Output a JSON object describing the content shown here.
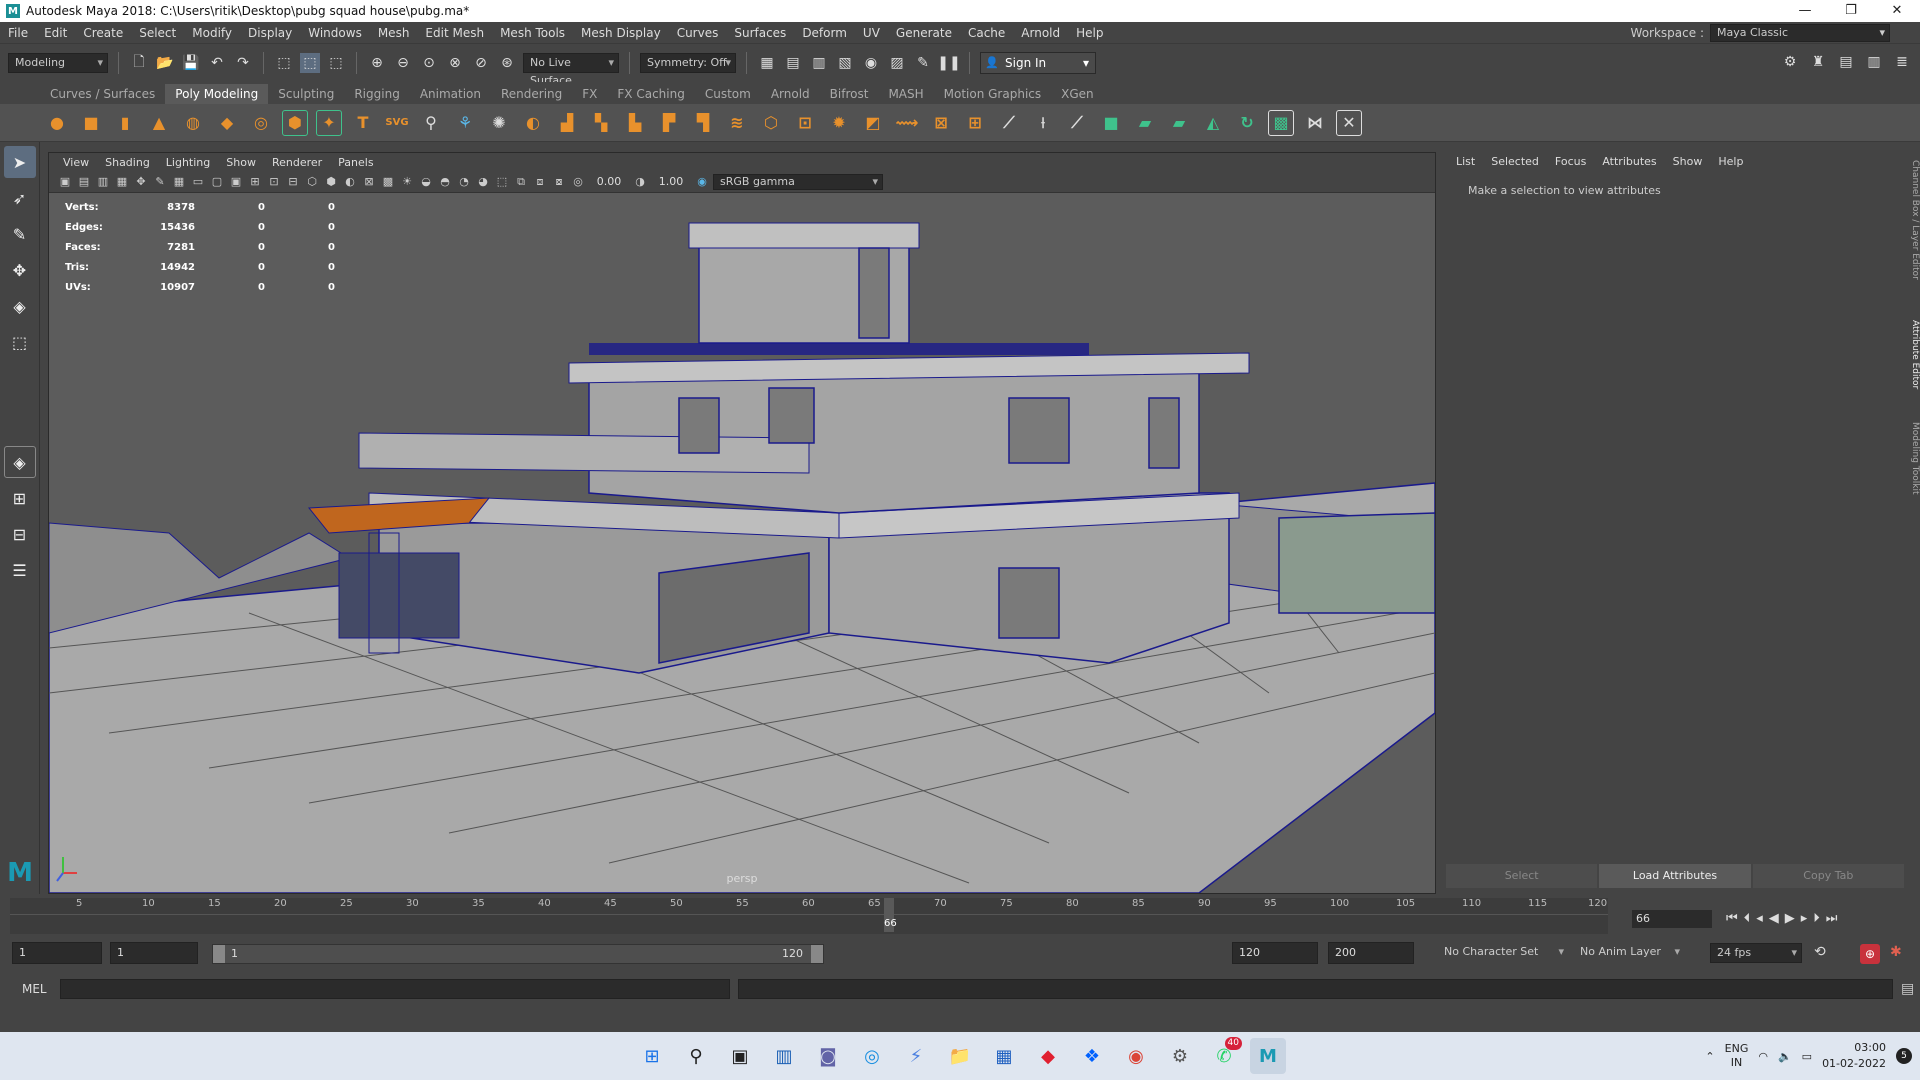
{
  "window": {
    "title": "Autodesk Maya 2018: C:\\Users\\ritik\\Desktop\\pubg squad house\\pubg.ma*",
    "minimize": "—",
    "maximize": "❐",
    "close": "✕"
  },
  "menubar": {
    "items": [
      "File",
      "Edit",
      "Create",
      "Select",
      "Modify",
      "Display",
      "Windows",
      "Mesh",
      "Edit Mesh",
      "Mesh Tools",
      "Mesh Display",
      "Curves",
      "Surfaces",
      "Deform",
      "UV",
      "Generate",
      "Cache",
      "Arnold",
      "Help"
    ],
    "workspace_label": "Workspace :",
    "workspace_value": "Maya Classic"
  },
  "statusline": {
    "menuset": "Modeling",
    "live_surface": "No Live Surface",
    "symmetry": "Symmetry: Off",
    "sign_in": "Sign In"
  },
  "shelf": {
    "tabs": [
      "Curves / Surfaces",
      "Poly Modeling",
      "Sculpting",
      "Rigging",
      "Animation",
      "Rendering",
      "FX",
      "FX Caching",
      "Custom",
      "Arnold",
      "Bifrost",
      "MASH",
      "Motion Graphics",
      "XGen"
    ],
    "active_tab": "Poly Modeling",
    "icons": [
      "sphere-icon",
      "cube-icon",
      "cylinder-icon",
      "cone-icon",
      "torus-icon",
      "plane-icon",
      "disc-icon",
      "platonic-icon",
      "super-shape-icon",
      "text-icon",
      "svg-icon",
      "combine-icon",
      "separate-icon",
      "smooth-icon",
      "extract-icon",
      "booleans-icon",
      "mirror-icon",
      "bevel-icon",
      "bridge-icon",
      "extrude-icon",
      "bridge-edge-icon",
      "append-icon",
      "fill-hole-icon",
      "merge-icon",
      "collapse-icon",
      "multi-cut-icon",
      "target-weld-icon",
      "insert-loop-icon",
      "offset-loop-icon",
      "planar-uv-icon",
      "auto-uv-icon",
      "cylindrical-uv-icon",
      "uv-editor-icon",
      "layout-uv-icon",
      "unfold-uv-icon",
      "cut-uv-icon",
      "sew-uv-icon"
    ],
    "text_icon_glyph": "T",
    "svg_icon_glyph": "SVG"
  },
  "viewport": {
    "menu": [
      "View",
      "Shading",
      "Lighting",
      "Show",
      "Renderer",
      "Panels"
    ],
    "exposure": "0.00",
    "gamma": "1.00",
    "color_space": "sRGB gamma",
    "camera": "persp",
    "hud": [
      {
        "label": "Verts:",
        "v1": "8378",
        "v2": "0",
        "v3": "0"
      },
      {
        "label": "Edges:",
        "v1": "15436",
        "v2": "0",
        "v3": "0"
      },
      {
        "label": "Faces:",
        "v1": "7281",
        "v2": "0",
        "v3": "0"
      },
      {
        "label": "Tris:",
        "v1": "14942",
        "v2": "0",
        "v3": "0"
      },
      {
        "label": "UVs:",
        "v1": "10907",
        "v2": "0",
        "v3": "0"
      }
    ]
  },
  "attribute_editor": {
    "menu": [
      "List",
      "Selected",
      "Focus",
      "Attributes",
      "Show",
      "Help"
    ],
    "message": "Make a selection to view attributes",
    "buttons": [
      "Select",
      "Load Attributes",
      "Copy Tab"
    ],
    "side_tabs": [
      "Channel Box / Layer Editor",
      "Attribute Editor",
      "Modeling Toolkit"
    ]
  },
  "timeline": {
    "ticks": [
      "5",
      "10",
      "15",
      "20",
      "25",
      "30",
      "35",
      "40",
      "45",
      "50",
      "55",
      "60",
      "65",
      "70",
      "75",
      "80",
      "85",
      "90",
      "95",
      "100",
      "105",
      "110",
      "115",
      "120"
    ],
    "current_frame": "66",
    "current_frame_field": "66"
  },
  "range": {
    "start": "1",
    "playback_start": "1",
    "range_start": "1",
    "range_end": "120",
    "playback_end": "120",
    "end": "200",
    "character_set": "No Character Set",
    "anim_layer": "No Anim Layer",
    "fps": "24 fps"
  },
  "cmdline": {
    "label": "MEL"
  },
  "taskbar": {
    "whatsapp_badge": "40",
    "lang_top": "ENG",
    "lang_bottom": "IN",
    "time": "03:00",
    "date": "01-02-2022",
    "notifications": "5"
  },
  "colors": {
    "shelf_orange": "#e8912c",
    "shelf_green": "#3fc28c",
    "wire": "#1a1a8c",
    "active_tool": "#5d6d80"
  }
}
